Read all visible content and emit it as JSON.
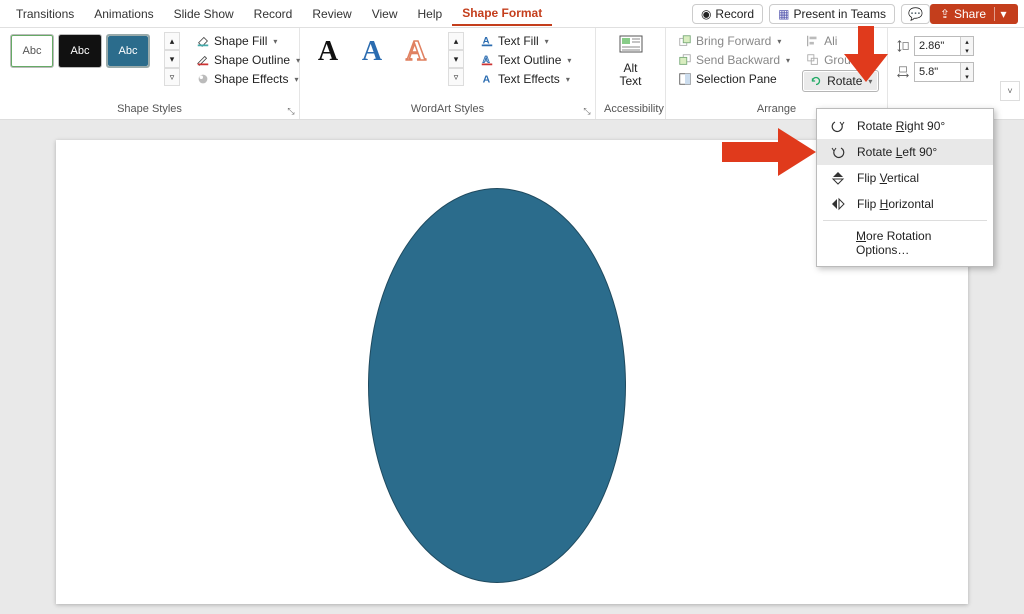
{
  "tabs": {
    "transitions": "Transitions",
    "animations": "Animations",
    "slideshow": "Slide Show",
    "record": "Record",
    "review": "Review",
    "view": "View",
    "help": "Help",
    "shapeformat": "Shape Format"
  },
  "topright": {
    "record": "Record",
    "present": "Present in Teams",
    "share": "Share"
  },
  "shapeStyles": {
    "label": "Shape Styles",
    "thumb_text": "Abc",
    "fill": "Shape Fill",
    "outline": "Shape Outline",
    "effects": "Shape Effects"
  },
  "wordart": {
    "label": "WordArt Styles",
    "glyph": "A",
    "textfill": "Text Fill",
    "textoutline": "Text Outline",
    "texteffects": "Text Effects"
  },
  "accessibility": {
    "label": "Accessibility",
    "alt_text_l1": "Alt",
    "alt_text_l2": "Text"
  },
  "arrange": {
    "label": "Arrange",
    "bring": "Bring Forward",
    "send": "Send Backward",
    "selection": "Selection Pane",
    "align": "Ali",
    "group": "Grou",
    "rotate": "Rotate"
  },
  "size": {
    "height": "2.86\"",
    "width": "5.8\""
  },
  "rotate_menu": {
    "right": "Rotate Right 90°",
    "left": "Rotate Left 90°",
    "flipv": "Flip Vertical",
    "fliph": "Flip Horizontal",
    "more": "More Rotation Options…",
    "right_mn": "R",
    "left_mn": "L",
    "flipv_mn": "V",
    "fliph_mn": "H",
    "more_mn": "M"
  }
}
